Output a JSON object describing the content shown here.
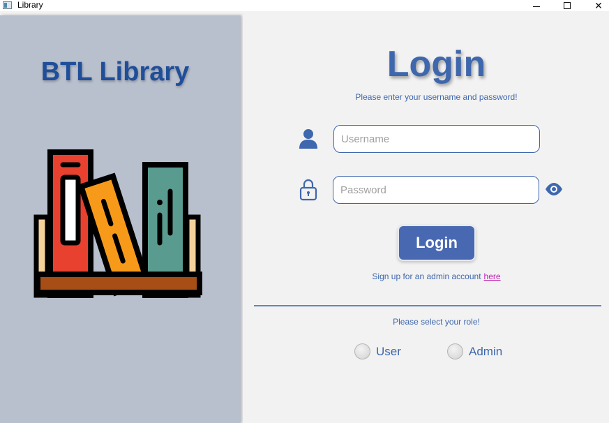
{
  "window": {
    "title": "Library",
    "minimize_icon": "minimize-icon",
    "maximize_icon": "maximize-icon",
    "close_glyph": "✕"
  },
  "sidebar": {
    "brand": "BTL Library",
    "illustration_icon": "books-on-shelf-icon"
  },
  "login": {
    "title": "Login",
    "subtitle": "Please enter your username and password!",
    "username_placeholder": "Username",
    "username_value": "",
    "password_placeholder": "Password",
    "password_value": "",
    "button_label": "Login",
    "signup_text": "Sign up for an admin account",
    "signup_link": "here"
  },
  "roles": {
    "prompt": "Please select your role!",
    "options": [
      {
        "label": "User",
        "selected": false
      },
      {
        "label": "Admin",
        "selected": false
      }
    ]
  },
  "colors": {
    "accent": "#3e67ad",
    "button": "#4868b2",
    "link": "#c21fb5",
    "sidebar_bg": "#b8bfcd",
    "brand": "#1f4e9a"
  }
}
